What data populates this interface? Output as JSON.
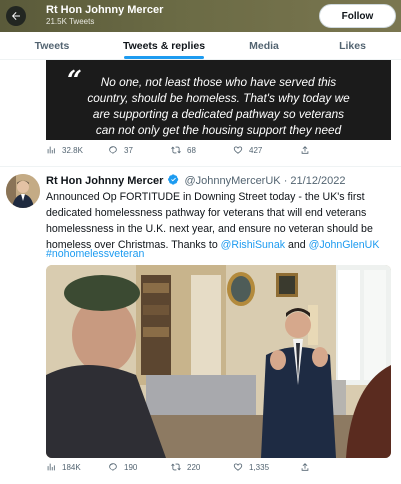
{
  "header": {
    "name": "Rt Hon Johnny Mercer",
    "tweet_count": "21.5K Tweets",
    "follow_label": "Follow"
  },
  "tabs": [
    {
      "label": "Tweets",
      "active": false
    },
    {
      "label": "Tweets & replies",
      "active": true
    },
    {
      "label": "Media",
      "active": false
    },
    {
      "label": "Likes",
      "active": false
    }
  ],
  "tweet1": {
    "quote_lines": [
      "No one, not least those who have served this",
      "country, should be homeless. That's why today we",
      "are supporting a dedicated pathway so veterans",
      "can not only get the housing support they need"
    ],
    "stats": {
      "views": "32.8K",
      "replies": "37",
      "retweets": "68",
      "likes": "427"
    }
  },
  "tweet2": {
    "name": "Rt Hon Johnny Mercer",
    "handle": "@JohnnyMercerUK",
    "date": "· 21/12/2022",
    "lines": [
      "Announced Op FORTITUDE in Downing Street today - the UK's first",
      "dedicated homelessness pathway for veterans that will end veterans",
      "homelessness in the U.K. next year, and ensure no veteran should be"
    ],
    "line4_text": "homeless over Christmas. Thanks to ",
    "mention1": "@RishiSunak",
    "and_text": " and ",
    "mention2": "@JohnGlenUK",
    "hashtag": "#nohomelessveteran",
    "stats": {
      "views": "184K",
      "replies": "190",
      "retweets": "220",
      "likes": "1,335"
    }
  },
  "colors": {
    "accent": "#1d9bf0",
    "header_bg": "#6b6b45",
    "secondary_text": "#536471"
  },
  "icons": [
    "back-arrow-icon",
    "views-icon",
    "reply-icon",
    "retweet-icon",
    "like-icon",
    "share-icon",
    "verified-badge-icon"
  ]
}
